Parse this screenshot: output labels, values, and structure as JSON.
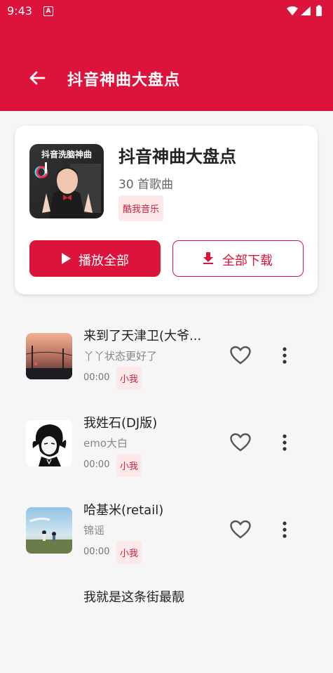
{
  "status_bar": {
    "time": "9:43",
    "notif_glyph": "A"
  },
  "app_bar": {
    "title": "抖音神曲大盘点"
  },
  "playlist": {
    "cover_text": "抖音洗脑神曲",
    "title": "抖音神曲大盘点",
    "count": "30 首歌曲",
    "source_tag": "酷我音乐",
    "play_all_label": "播放全部",
    "download_all_label": "全部下载"
  },
  "songs": [
    {
      "title": "来到了天津卫(大爷...",
      "artist": "丫丫状态更好了",
      "duration": "00:00",
      "tag": "小我"
    },
    {
      "title": "我姓石(DJ版)",
      "artist": "emo大白",
      "duration": "00:00",
      "tag": "小我"
    },
    {
      "title": "哈基米(retail)",
      "artist": "锦谣",
      "duration": "00:00",
      "tag": "小我"
    },
    {
      "title": "我就是这条街最靓",
      "artist": "",
      "duration": "",
      "tag": ""
    }
  ],
  "colors": {
    "accent": "#dc143c",
    "tag_bg": "#fde8ea",
    "tag_text": "#d0213f"
  },
  "icons": [
    "back-arrow-icon",
    "play-icon",
    "download-icon",
    "heart-icon",
    "more-vert-icon",
    "wifi-icon",
    "signal-icon",
    "battery-icon"
  ]
}
